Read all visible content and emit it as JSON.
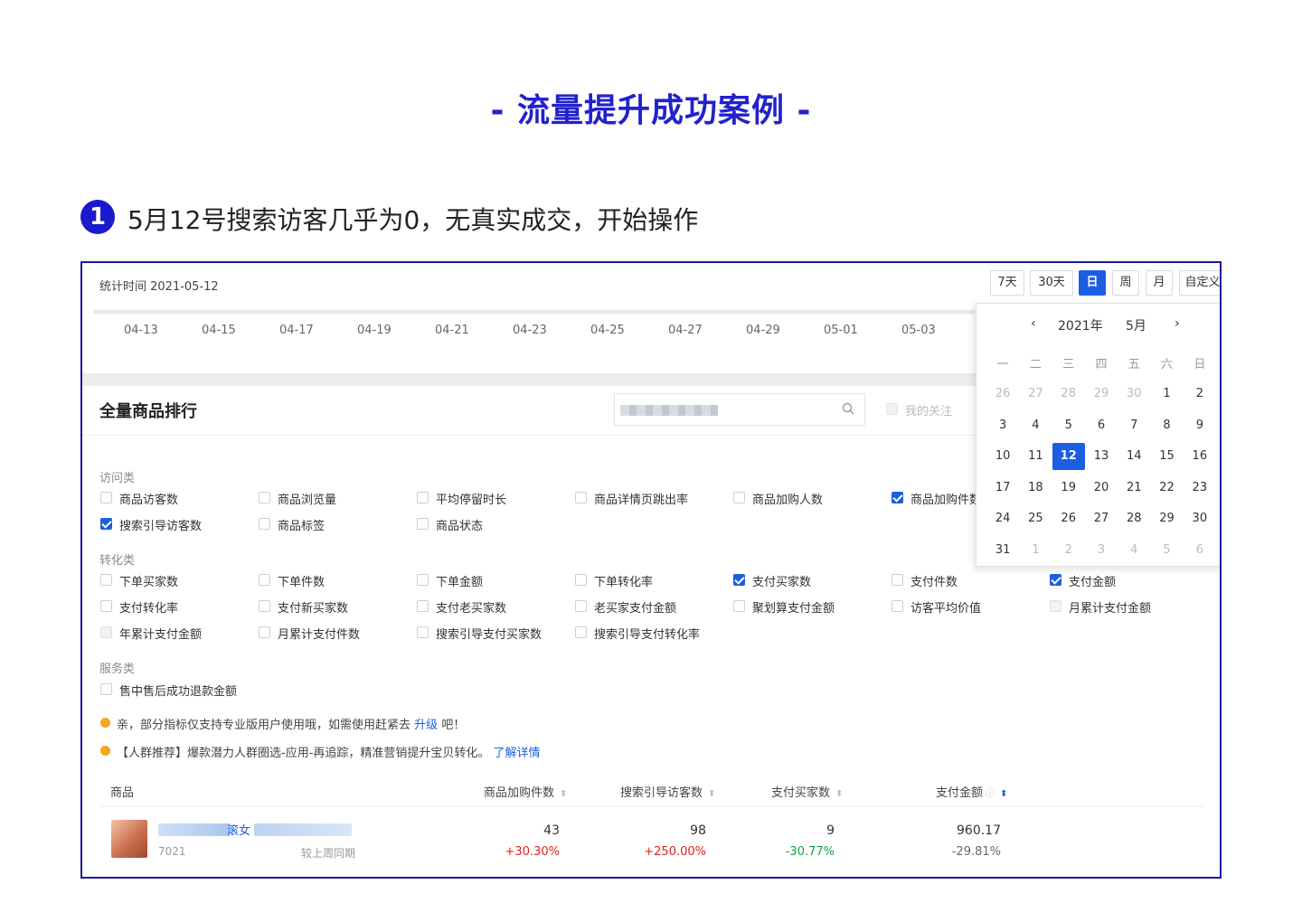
{
  "header": {
    "title": "- 流量提升成功案例 -"
  },
  "step": {
    "number": "1",
    "text": "5月12号搜索访客几乎为0，无真实成交，开始操作"
  },
  "toolbar": {
    "stat_time": "统计时间 2021-05-12",
    "range_buttons": [
      "7天",
      "30天",
      "日",
      "周",
      "月",
      "自定义"
    ],
    "active_range": "日"
  },
  "date_axis": [
    "04-13",
    "04-15",
    "04-17",
    "04-19",
    "04-21",
    "04-23",
    "04-25",
    "04-27",
    "04-29",
    "05-01",
    "05-03"
  ],
  "section": {
    "title": "全量商品排行",
    "search_icon": "search-icon",
    "fav_label": "我的关注"
  },
  "categories": [
    {
      "label": "访问类",
      "items": [
        {
          "label": "商品访客数",
          "checked": false
        },
        {
          "label": "商品浏览量",
          "checked": false
        },
        {
          "label": "平均停留时长",
          "checked": false
        },
        {
          "label": "商品详情页跳出率",
          "checked": false
        },
        {
          "label": "商品加购人数",
          "checked": false
        },
        {
          "label": "商品加购件数",
          "checked": true
        },
        {
          "label": "搜索引导访客数",
          "checked": true
        },
        {
          "label": "商品标签",
          "checked": false
        },
        {
          "label": "商品状态",
          "checked": false
        }
      ]
    },
    {
      "label": "转化类",
      "items": [
        {
          "label": "下单买家数",
          "checked": false
        },
        {
          "label": "下单件数",
          "checked": false
        },
        {
          "label": "下单金额",
          "checked": false
        },
        {
          "label": "下单转化率",
          "checked": false
        },
        {
          "label": "支付买家数",
          "checked": true
        },
        {
          "label": "支付件数",
          "checked": false
        },
        {
          "label": "支付金额",
          "checked": true
        },
        {
          "label": "支付转化率",
          "checked": false
        },
        {
          "label": "支付新买家数",
          "checked": false
        },
        {
          "label": "支付老买家数",
          "checked": false
        },
        {
          "label": "老买家支付金额",
          "checked": false
        },
        {
          "label": "聚划算支付金额",
          "checked": false
        },
        {
          "label": "访客平均价值",
          "checked": false
        },
        {
          "label": "月累计支付金额",
          "checked": false,
          "disabled": true
        },
        {
          "label": "年累计支付金额",
          "checked": false,
          "disabled": true
        },
        {
          "label": "月累计支付件数",
          "checked": false
        },
        {
          "label": "搜索引导支付买家数",
          "checked": false
        },
        {
          "label": "搜索引导支付转化率",
          "checked": false
        }
      ]
    },
    {
      "label": "服务类",
      "items": [
        {
          "label": "售中售后成功退款金额",
          "checked": false
        }
      ]
    }
  ],
  "notices": {
    "n1_text": "亲，部分指标仅支持专业版用户使用哦，如需使用赶紧去",
    "n1_link": "升级",
    "n1_tail": "吧！",
    "n2_text": "【人群推荐】爆款潜力人群圈选-应用-再追踪，精准营销提升宝贝转化。",
    "n2_link": "了解详情"
  },
  "table": {
    "headers": [
      "商品",
      "商品加购件数",
      "搜索引导访客数",
      "支付买家数",
      "支付金额"
    ],
    "row": {
      "name_fragment": "滚女",
      "id": "7021",
      "compare_label": "较上周同期",
      "values": [
        "43",
        "98",
        "9",
        "960.17"
      ],
      "changes": [
        "+30.30%",
        "+250.00%",
        "-30.77%",
        "-29.81%"
      ]
    }
  },
  "calendar": {
    "year_label": "2021年",
    "month_label": "5月",
    "weekdays": [
      "一",
      "二",
      "三",
      "四",
      "五",
      "六",
      "日"
    ],
    "weeks": [
      [
        "26",
        "27",
        "28",
        "29",
        "30",
        "1",
        "2"
      ],
      [
        "3",
        "4",
        "5",
        "6",
        "7",
        "8",
        "9"
      ],
      [
        "10",
        "11",
        "12",
        "13",
        "14",
        "15",
        "16"
      ],
      [
        "17",
        "18",
        "19",
        "20",
        "21",
        "22",
        "23"
      ],
      [
        "24",
        "25",
        "26",
        "27",
        "28",
        "29",
        "30"
      ],
      [
        "31",
        "1",
        "2",
        "3",
        "4",
        "5",
        "6"
      ]
    ],
    "selected": "12"
  },
  "colors": {
    "accent": "#1b5fe0",
    "title": "#2222cc",
    "positive": "#e02020",
    "negative": "#1a9e4a"
  }
}
